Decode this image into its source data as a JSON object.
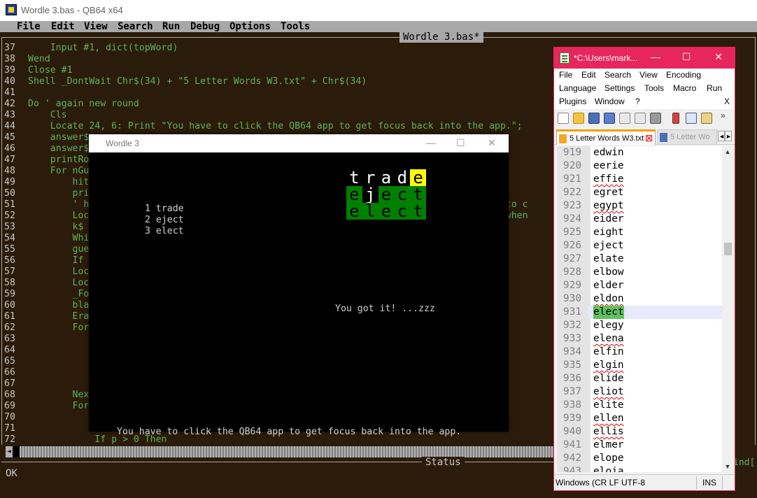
{
  "qb64": {
    "window_title": "Wordle 3.bas - QB64 x64",
    "menu": [
      "File",
      "Edit",
      "View",
      "Search",
      "Run",
      "Debug",
      "Options",
      "Tools"
    ],
    "document_title": "Wordle 3.bas*",
    "code_lines": [
      {
        "n": "37",
        "text": "    Input #1, dict(topWord)"
      },
      {
        "n": "38",
        "text": "Wend"
      },
      {
        "n": "39",
        "text": "Close #1"
      },
      {
        "n": "40",
        "text": "Shell _DontWait Chr$(34) + \"5 Letter Words W3.txt\" + Chr$(34)"
      },
      {
        "n": "41",
        "text": ""
      },
      {
        "n": "42",
        "text": "Do ' again new round"
      },
      {
        "n": "43",
        "text": "    Cls"
      },
      {
        "n": "44",
        "text": "    Locate 24, 6: Print \"You have to click the QB64 app to get focus back into the app.\";"
      },
      {
        "n": "45",
        "text": "    answer$"
      },
      {
        "n": "46",
        "text": "    answer$"
      },
      {
        "n": "47",
        "text": "    printRo"
      },
      {
        "n": "48",
        "text": "    For nGu"
      },
      {
        "n": "49",
        "text": "        hit"
      },
      {
        "n": "50",
        "text": "        pri"
      },
      {
        "n": "51",
        "text": "        ' h                                                                      g it to c"
      },
      {
        "n": "52",
        "text": "        Loc                                                                      nter when"
      },
      {
        "n": "53",
        "text": "        k$"
      },
      {
        "n": "54",
        "text": "        Whi"
      },
      {
        "n": "55",
        "text": "        gue"
      },
      {
        "n": "56",
        "text": "        If"
      },
      {
        "n": "57",
        "text": "        Loc"
      },
      {
        "n": "58",
        "text": "        Loc"
      },
      {
        "n": "59",
        "text": "        _Fo"
      },
      {
        "n": "60",
        "text": "        bla"
      },
      {
        "n": "61",
        "text": "        Era"
      },
      {
        "n": "62",
        "text": "        For"
      },
      {
        "n": "63",
        "text": ""
      },
      {
        "n": "64",
        "text": ""
      },
      {
        "n": "65",
        "text": "                                                                                ults"
      },
      {
        "n": "66",
        "text": ""
      },
      {
        "n": "67",
        "text": ""
      },
      {
        "n": "68",
        "text": "        Nex"
      },
      {
        "n": "69",
        "text": "        For"
      },
      {
        "n": "70",
        "text": ""
      },
      {
        "n": "71",
        "text": ""
      },
      {
        "n": "72",
        "text": "            If p > 0 Then"
      }
    ],
    "status_title": "Status",
    "status_text": "OK",
    "right_peek": "ind["
  },
  "wordle": {
    "window_title": "Wordle 3",
    "guesses": [
      "1 trade",
      "2 eject",
      "3 elect"
    ],
    "board": [
      [
        {
          "c": "t",
          "s": "absent"
        },
        {
          "c": "r",
          "s": "absent"
        },
        {
          "c": "a",
          "s": "absent"
        },
        {
          "c": "d",
          "s": "absent"
        },
        {
          "c": "e",
          "s": "present"
        }
      ],
      [
        {
          "c": "e",
          "s": "correct"
        },
        {
          "c": "j",
          "s": "absent"
        },
        {
          "c": "e",
          "s": "correct"
        },
        {
          "c": "c",
          "s": "correct"
        },
        {
          "c": "t",
          "s": "correct"
        }
      ],
      [
        {
          "c": "e",
          "s": "correct"
        },
        {
          "c": "l",
          "s": "correct"
        },
        {
          "c": "e",
          "s": "correct"
        },
        {
          "c": "c",
          "s": "correct"
        },
        {
          "c": "t",
          "s": "correct"
        }
      ]
    ],
    "message": "You got it! ...zzz",
    "hint": "You have to click the QB64 app to get focus back into the app."
  },
  "notepadpp": {
    "window_title": "*C:\\Users\\mark...",
    "menu_rows": [
      [
        "File",
        "Edit",
        "Search",
        "View",
        "Encoding"
      ],
      [
        "Language",
        "Settings",
        "Tools",
        "Macro",
        "Run"
      ],
      [
        "Plugins",
        "Window",
        "?"
      ]
    ],
    "menu_close": "X",
    "tabs": {
      "active": "5 Letter Words W3.txt",
      "inactive": "5 Letter Wo"
    },
    "lines": [
      {
        "n": "919",
        "w": "edwin",
        "spell": false
      },
      {
        "n": "920",
        "w": "eerie",
        "spell": false
      },
      {
        "n": "921",
        "w": "effie",
        "spell": true
      },
      {
        "n": "922",
        "w": "egret",
        "spell": false
      },
      {
        "n": "923",
        "w": "egypt",
        "spell": true
      },
      {
        "n": "924",
        "w": "eider",
        "spell": false
      },
      {
        "n": "925",
        "w": "eight",
        "spell": false
      },
      {
        "n": "926",
        "w": "eject",
        "spell": false
      },
      {
        "n": "927",
        "w": "elate",
        "spell": false
      },
      {
        "n": "928",
        "w": "elbow",
        "spell": false
      },
      {
        "n": "929",
        "w": "elder",
        "spell": false
      },
      {
        "n": "930",
        "w": "eldon",
        "spell": true
      },
      {
        "n": "931",
        "w": "elect",
        "spell": false,
        "current": true
      },
      {
        "n": "932",
        "w": "elegy",
        "spell": false
      },
      {
        "n": "933",
        "w": "elena",
        "spell": true
      },
      {
        "n": "934",
        "w": "elfin",
        "spell": false
      },
      {
        "n": "935",
        "w": "elgin",
        "spell": true
      },
      {
        "n": "936",
        "w": "elide",
        "spell": false
      },
      {
        "n": "937",
        "w": "eliot",
        "spell": true
      },
      {
        "n": "938",
        "w": "elite",
        "spell": false
      },
      {
        "n": "939",
        "w": "ellen",
        "spell": true
      },
      {
        "n": "940",
        "w": "ellis",
        "spell": true
      },
      {
        "n": "941",
        "w": "elmer",
        "spell": false
      },
      {
        "n": "942",
        "w": "elope",
        "spell": false
      },
      {
        "n": "943",
        "w": "eloia",
        "spell": false
      }
    ],
    "status": {
      "encoding": "Windows (CR LF UTF-8",
      "mode": "INS"
    },
    "accent": "#e6265c"
  }
}
